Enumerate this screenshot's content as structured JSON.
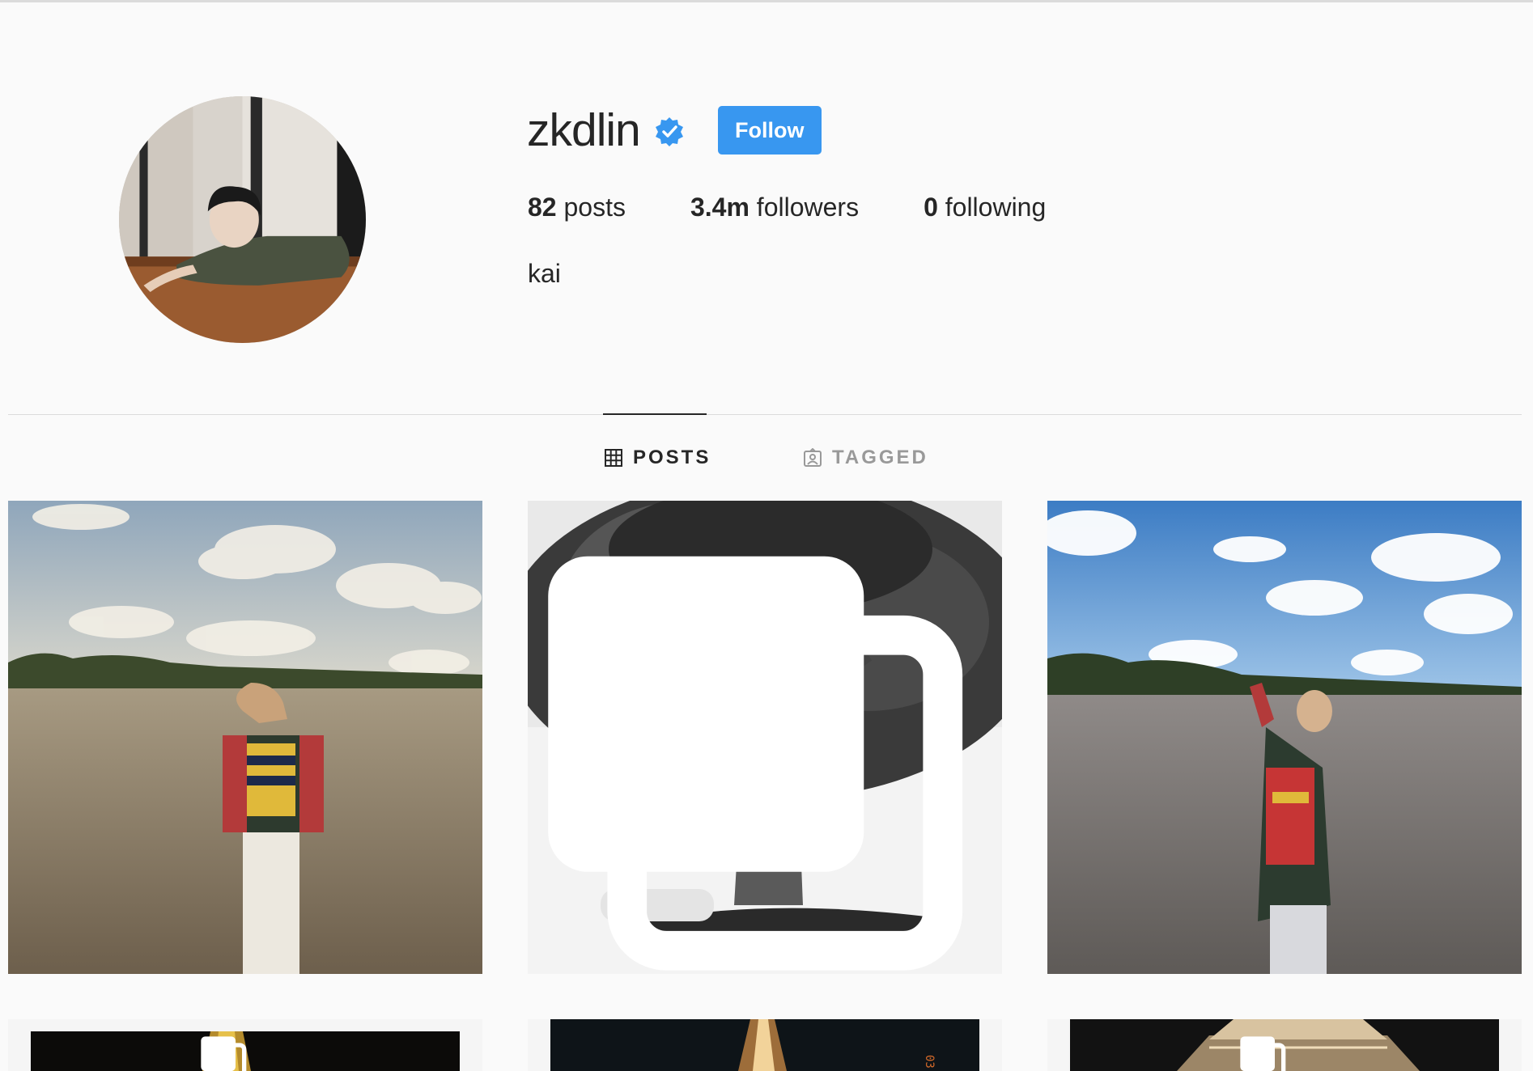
{
  "profile": {
    "username": "zkdlin",
    "verified_icon": "verified-badge-icon",
    "follow_label": "Follow",
    "posts_count": "82",
    "posts_label": "posts",
    "followers_count": "3.4m",
    "followers_label": "followers",
    "following_count": "0",
    "following_label": "following",
    "bio": "kai"
  },
  "tabs": [
    {
      "label": "POSTS",
      "icon": "grid-icon",
      "active": true
    },
    {
      "label": "TAGGED",
      "icon": "tagged-icon",
      "active": false
    }
  ],
  "posts": [
    {
      "row": 1,
      "col": 1,
      "multi": false,
      "scene": "field-color-cloudy"
    },
    {
      "row": 1,
      "col": 2,
      "multi": true,
      "scene": "tree-black-white"
    },
    {
      "row": 1,
      "col": 3,
      "multi": false,
      "scene": "field-blue-sky"
    },
    {
      "row": 2,
      "col": 1,
      "multi": true,
      "scene": "eiffel-tower-night"
    },
    {
      "row": 2,
      "col": 2,
      "multi": false,
      "scene": "eiffel-tower-film"
    },
    {
      "row": 2,
      "col": 3,
      "multi": true,
      "scene": "eiffel-tower-lit"
    }
  ],
  "colors": {
    "accent": "#3897f0",
    "text": "#262626",
    "muted": "#999999",
    "background": "#fafafa",
    "divider": "#dbdbdb"
  }
}
